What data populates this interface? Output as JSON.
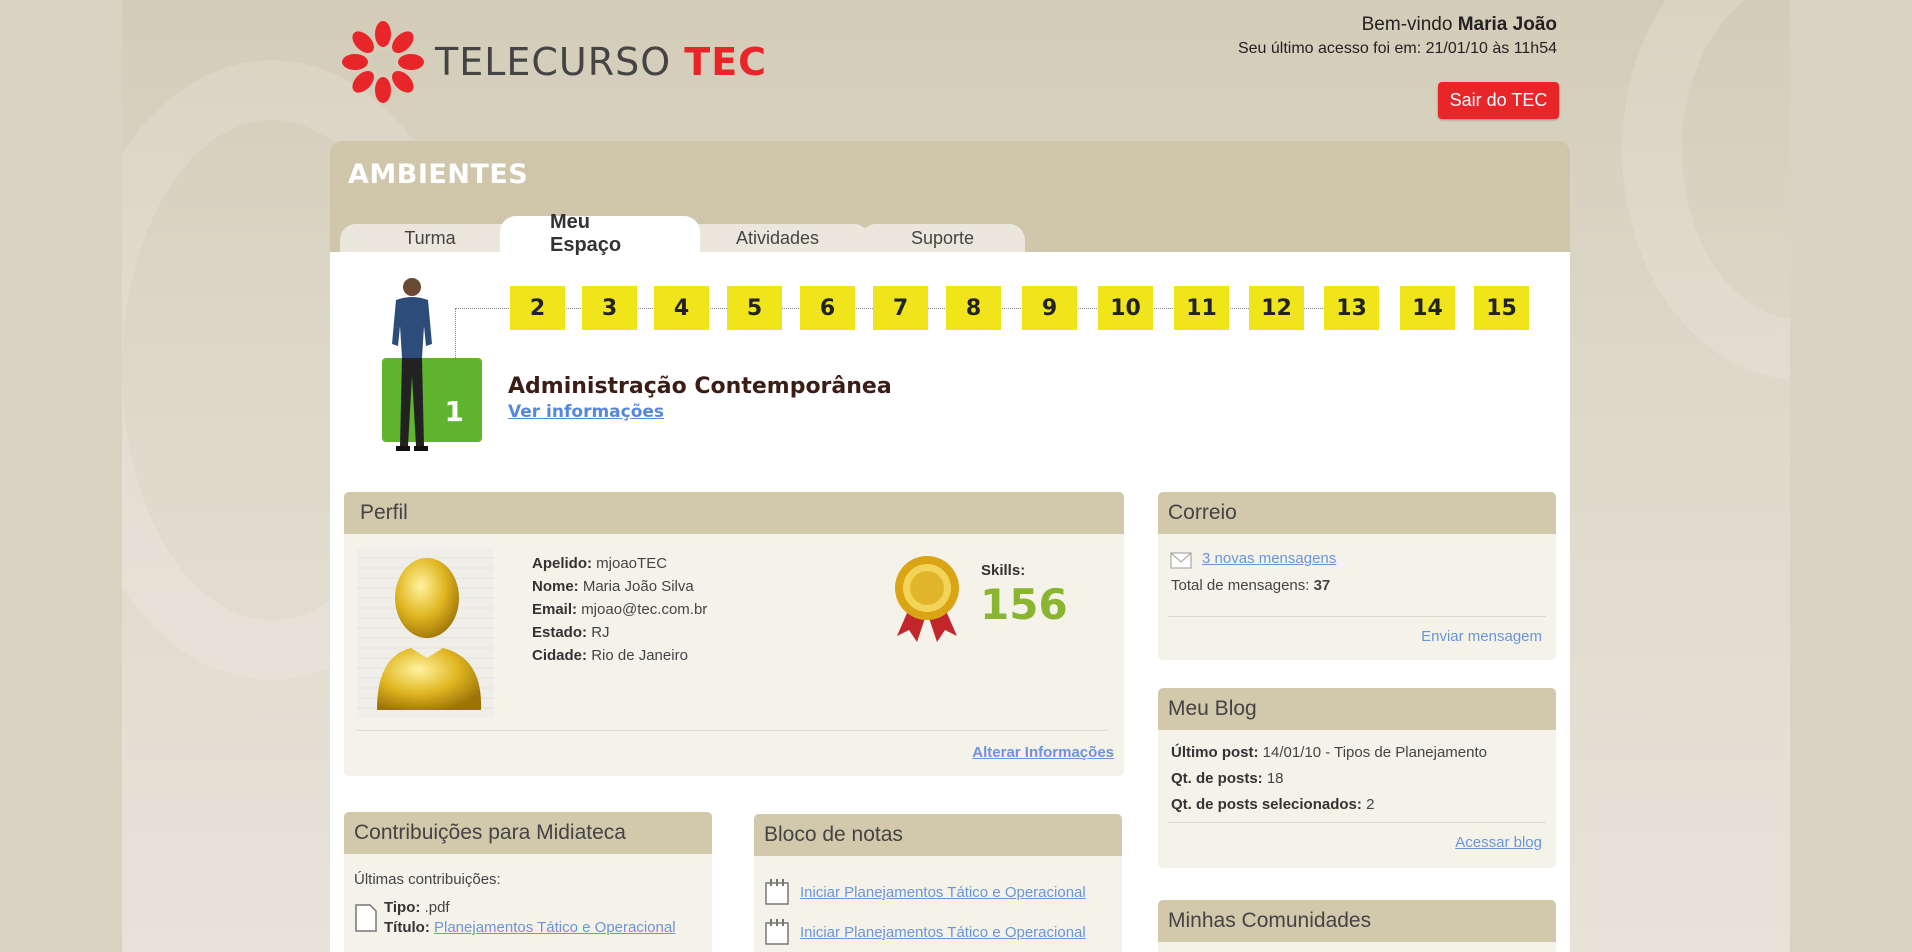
{
  "header": {
    "brand_left": "TELECURSO",
    "brand_right": "TEC",
    "welcome_prefix": "Bem-vindo",
    "user_name": "Maria João",
    "last_access": "Seu último acesso foi em: 21/01/10 às 11h54",
    "logout_label": "Sair do TEC"
  },
  "panel": {
    "title": "AMBIENTES",
    "tabs": [
      {
        "label": "Turma"
      },
      {
        "label": "Meu Espaço"
      },
      {
        "label": "Atividades"
      },
      {
        "label": "Suporte"
      }
    ],
    "active_tab": "Meu Espaço"
  },
  "progress": {
    "current_module": "1",
    "modules": [
      "2",
      "3",
      "4",
      "5",
      "6",
      "7",
      "8",
      "9",
      "10",
      "11",
      "12",
      "13",
      "14",
      "15"
    ],
    "course_title": "Administração Contemporânea",
    "course_link": "Ver informações"
  },
  "profile": {
    "title": "Perfil",
    "fields": [
      {
        "label": "Apelido:",
        "value": "mjoaoTEC"
      },
      {
        "label": "Nome:",
        "value": "Maria João Silva"
      },
      {
        "label": "Email:",
        "value": "mjoao@tec.com.br"
      },
      {
        "label": "Estado:",
        "value": "RJ"
      },
      {
        "label": "Cidade:",
        "value": "Rio de Janeiro"
      }
    ],
    "skills_label": "Skills:",
    "skills_value": "156",
    "edit_link": "Alterar Informações"
  },
  "mail": {
    "title": "Correio",
    "new_messages": "3 novas mensagens",
    "total_label": "Total de mensagens:",
    "total_value": "37",
    "send_link": "Enviar mensagem"
  },
  "blog": {
    "title": "Meu Blog",
    "last_post_label": "Último post:",
    "last_post_value": "14/01/10 - Tipos de Planejamento",
    "posts_label": "Qt. de posts:",
    "posts_value": "18",
    "selected_label": "Qt. de posts selecionados:",
    "selected_value": "2",
    "access_link": "Acessar blog"
  },
  "media": {
    "title": "Contribuições para  Midiateca",
    "subtitle": "Últimas contribuições:",
    "type_label": "Tipo:",
    "type_value": ".pdf",
    "item_title_label": "Título:",
    "item_title_value": "Planejamentos Tático e Operacional"
  },
  "notes": {
    "title": "Bloco de notas",
    "items": [
      "Iniciar Planejamentos Tático e Operacional",
      "Iniciar Planejamentos Tático e Operacional"
    ]
  },
  "communities": {
    "title": "Minhas Comunidades"
  },
  "colors": {
    "accent_red": "#e8262a",
    "module_green": "#5fb52e",
    "module_yellow": "#f0e51a",
    "skills_green": "#8ab531",
    "link_blue": "#6a95d8"
  }
}
